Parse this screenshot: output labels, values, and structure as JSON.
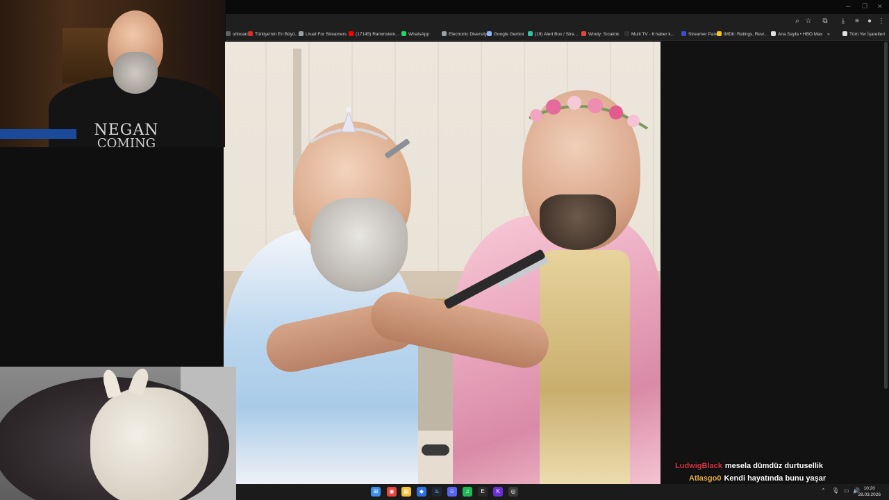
{
  "browser": {
    "toolbar": {
      "zoom_icon": "zoom-icon",
      "star_icon": "star-icon",
      "extensions_icon": "puzzle-icon",
      "download_icon": "download-icon",
      "menu_icon": "kebab-menu-icon"
    },
    "bookmarks": [
      {
        "label": "shboard",
        "color": "#5f6368"
      },
      {
        "label": "Türkiye'nin En Büyü...",
        "color": "#d93025"
      },
      {
        "label": "Livad For Streamers",
        "color": "#9aa0a6"
      },
      {
        "label": "(17145) Rammstein...",
        "color": "#ff0000"
      },
      {
        "label": "WhatsApp",
        "color": "#25d366"
      },
      {
        "label": "Electronic Diversity...",
        "color": "#9aa0a6"
      },
      {
        "label": "Google Gemini",
        "color": "#8ab4f8"
      },
      {
        "label": "(19) Alert Box / Stre...",
        "color": "#31c3a2"
      },
      {
        "label": "Windy: Sıcaklık",
        "color": "#e8453c"
      },
      {
        "label": "Multi TV - 6 haber k...",
        "color": "#333333"
      },
      {
        "label": "Streamer Panel",
        "color": "#3d4fd1"
      },
      {
        "label": "IMDb: Ratings, Revi...",
        "color": "#f5c518"
      },
      {
        "label": "Ana Sayfa • HBO Max",
        "color": "#e0e0e0"
      },
      {
        "label": "»",
        "color": ""
      },
      {
        "label": "Tüm Yer İşaretleri",
        "color": "#e0e0e0"
      }
    ]
  },
  "webcam": {
    "shirt_line1": "NEGAN",
    "shirt_line2": "COMING"
  },
  "chat": {
    "messages": [
      {
        "user": "LudwigBlack",
        "text": "mesela dümdüz durtusellik"
      },
      {
        "user": "Atlasgo0",
        "text": "Kendi hayatında bunu yaşar"
      }
    ]
  },
  "taskbar": {
    "apps": [
      {
        "name": "windows-start-icon",
        "color": "#3b8eea",
        "glyph": "⊞"
      },
      {
        "name": "chrome-icon",
        "color": "#e8453c",
        "glyph": "◉"
      },
      {
        "name": "file-explorer-icon",
        "color": "#f3c13a",
        "glyph": "▤"
      },
      {
        "name": "app-blue-icon",
        "color": "#2f6fe0",
        "glyph": "◆"
      },
      {
        "name": "steam-icon",
        "color": "#1b2838",
        "glyph": "♨"
      },
      {
        "name": "discord-icon",
        "color": "#5865f2",
        "glyph": "☺"
      },
      {
        "name": "spotify-icon",
        "color": "#1db954",
        "glyph": "♫"
      },
      {
        "name": "epic-games-icon",
        "color": "#2a2a2a",
        "glyph": "E"
      },
      {
        "name": "kick-app-icon",
        "color": "#6b2fd6",
        "glyph": "K"
      },
      {
        "name": "obs-icon",
        "color": "#3a3a3a",
        "glyph": "◎"
      }
    ],
    "time": "10:20",
    "date": "28.03.2026"
  }
}
